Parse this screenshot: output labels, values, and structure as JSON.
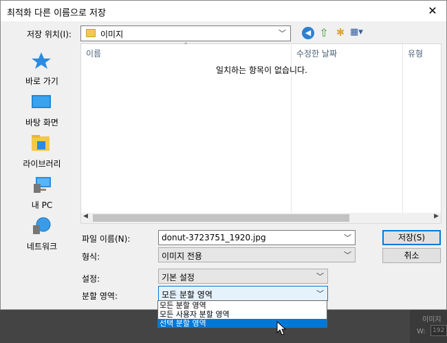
{
  "dialog": {
    "title": "최적화 다른 이름으로 저장",
    "close_glyph": "✕"
  },
  "save_in": {
    "label": "저장 위치(I):",
    "value": "이미지"
  },
  "toolbar": {
    "icons": [
      "back-icon",
      "up-folder-icon",
      "new-folder-icon",
      "view-menu-icon"
    ]
  },
  "places": [
    {
      "label": "바로 가기",
      "icon": "star-icon"
    },
    {
      "label": "바탕 화면",
      "icon": "desktop-icon"
    },
    {
      "label": "라이브러리",
      "icon": "library-icon"
    },
    {
      "label": "내 PC",
      "icon": "computer-icon"
    },
    {
      "label": "네트워크",
      "icon": "network-icon"
    }
  ],
  "file_list": {
    "columns": [
      "이름",
      "수정한 날짜",
      "유형"
    ],
    "empty_message": "일치하는 항목이 없습니다."
  },
  "form": {
    "filename_label": "파일 이름(N):",
    "filename_value": "donut-3723751_1920.jpg",
    "format_label": "형식:",
    "format_value": "이미지 전용",
    "settings_label": "설정:",
    "settings_value": "기본 설정",
    "region_label": "분할 영역:",
    "region_value": "모든 분할 영역",
    "region_options": [
      "모든 분할 영역",
      "모든 사용자 분할 영역",
      "선택 분할 영역"
    ],
    "region_highlighted": "선택 분할 영역"
  },
  "buttons": {
    "save": "저장(S)",
    "cancel": "취소"
  },
  "background_app": {
    "panel_label": "이미지",
    "w_label": "W:",
    "w_value": "192"
  },
  "colors": {
    "accent": "#0078d7",
    "dialog_bg": "#f0f0f0",
    "workspace_bg": "#444444"
  }
}
